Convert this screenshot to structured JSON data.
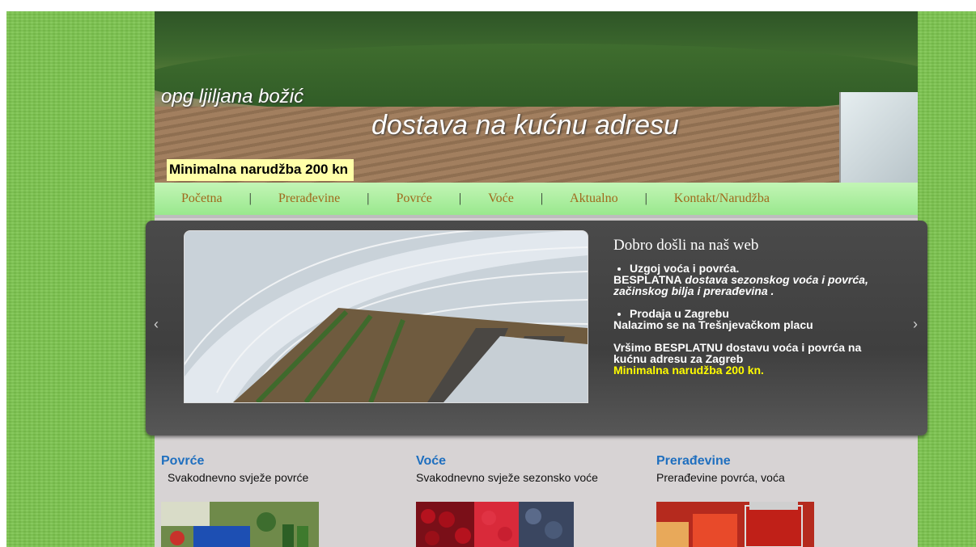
{
  "header": {
    "site_name": "opg ljiljana božić",
    "tagline": "dostava na kućnu adresu",
    "min_order_badge": "Minimalna narudžba 200 kn"
  },
  "nav": {
    "items": [
      "Početna",
      "Prerađevine",
      "Povrće",
      "Voće",
      "Aktualno",
      "Kontakt/Narudžba"
    ],
    "separator": "|"
  },
  "slider": {
    "prev_label": "‹",
    "next_label": "›",
    "title": "Dobro došli na naš web",
    "bullet1": "Uzgoj voća i povrća.",
    "free_word": "BESPLATNA",
    "free_rest": "dostava sezonskog voća i povrća, začinskog bilja  i prerađevina .",
    "bullet2": "Prodaja u Zagrebu",
    "location": "Nalazimo se  na  Trešnjevačkom placu",
    "delivery": "Vršimo BESPLATNU dostavu voća i povrća na kućnu adresu  za  Zagreb",
    "minimum": "Minimalna narudžba 200 kn."
  },
  "categories": [
    {
      "title": "Povrće",
      "desc": "Svakodnevno svježe povrće"
    },
    {
      "title": "Voće",
      "desc": "Svakodnevno svježe sezonsko voće"
    },
    {
      "title": "Prerađevine",
      "desc": "Prerađevine povrća, voća"
    }
  ]
}
